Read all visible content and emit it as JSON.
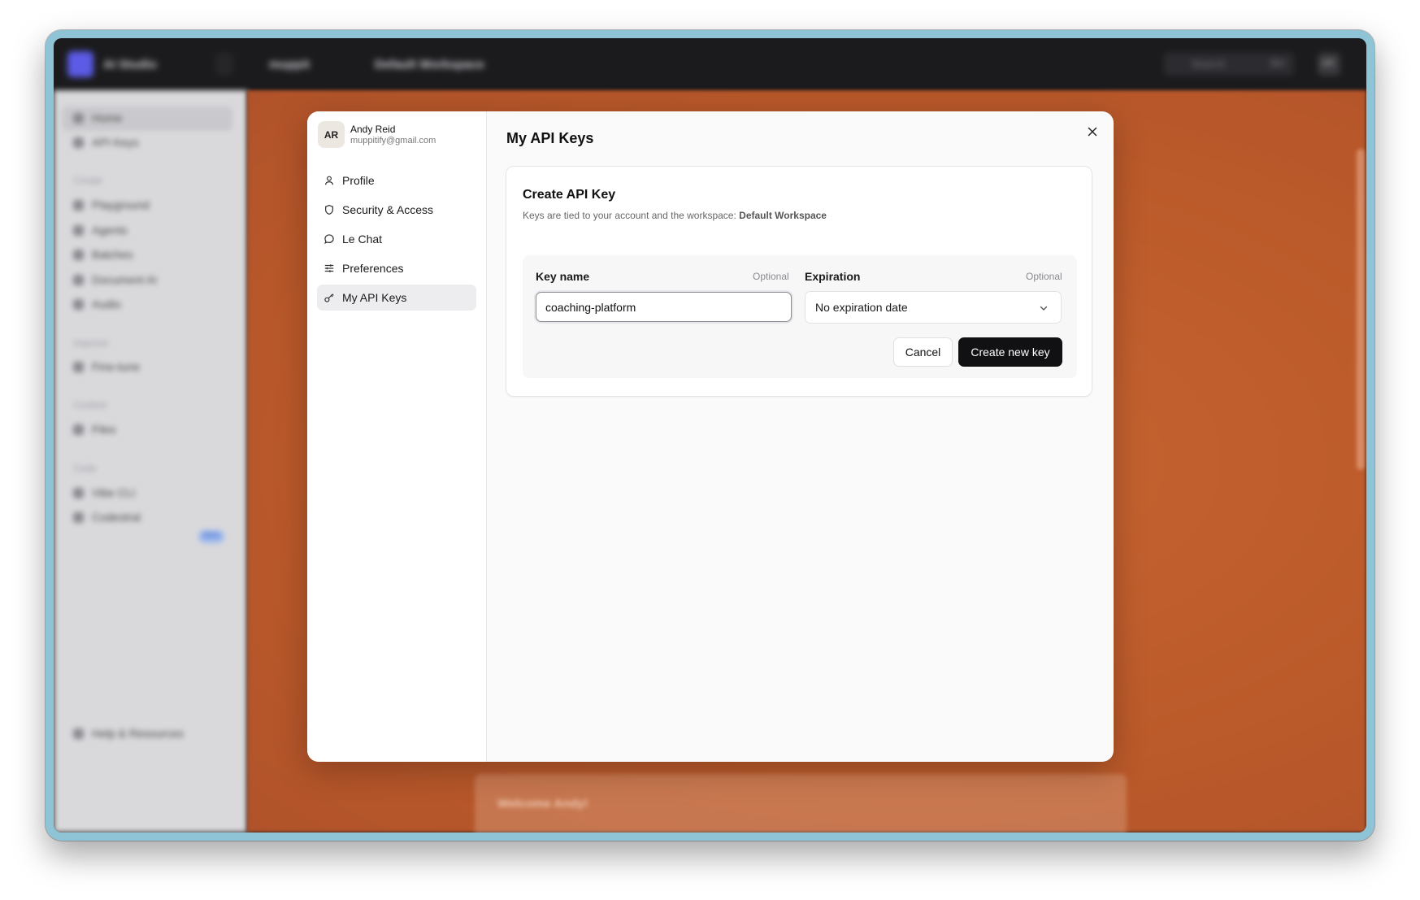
{
  "background": {
    "topbar": {
      "app_name": "AI Studio",
      "org": "muppit",
      "workspace": "Default Workspace",
      "search": "Search",
      "search_shortcut": "⌘K",
      "user_initials": "AR"
    },
    "sidebar": {
      "items": [
        "Home",
        "API Keys"
      ],
      "sections": [
        {
          "title": "Create",
          "items": [
            "Playground",
            "Agents",
            "Batches",
            "Document AI",
            "Audio"
          ]
        },
        {
          "title": "Improve",
          "items": [
            "Fine-tune"
          ]
        },
        {
          "title": "Context",
          "items": [
            "Files"
          ]
        },
        {
          "title": "Code",
          "items": [
            "Vibe CLI",
            "Codestral"
          ]
        }
      ],
      "badge": "New",
      "footer": "Help & Resources"
    },
    "welcome": "Welcome Andy!"
  },
  "modal": {
    "user": {
      "initials": "AR",
      "name": "Andy Reid",
      "email": "muppitify@gmail.com"
    },
    "nav": [
      {
        "label": "Profile",
        "icon": "user-icon"
      },
      {
        "label": "Security & Access",
        "icon": "shield-icon"
      },
      {
        "label": "Le Chat",
        "icon": "chat-bubble-icon"
      },
      {
        "label": "Preferences",
        "icon": "sliders-icon"
      },
      {
        "label": "My API Keys",
        "icon": "key-icon",
        "active": true
      }
    ],
    "title": "My API Keys",
    "card": {
      "title": "Create API Key",
      "description": "Keys are tied to your account and the workspace:",
      "workspace": "Default Workspace",
      "key_name_label": "Key name",
      "key_name_optional": "Optional",
      "key_name_value": "coaching-platform",
      "expiration_label": "Expiration",
      "expiration_optional": "Optional",
      "expiration_value": "No expiration date",
      "cancel_label": "Cancel",
      "create_label": "Create new key"
    }
  }
}
